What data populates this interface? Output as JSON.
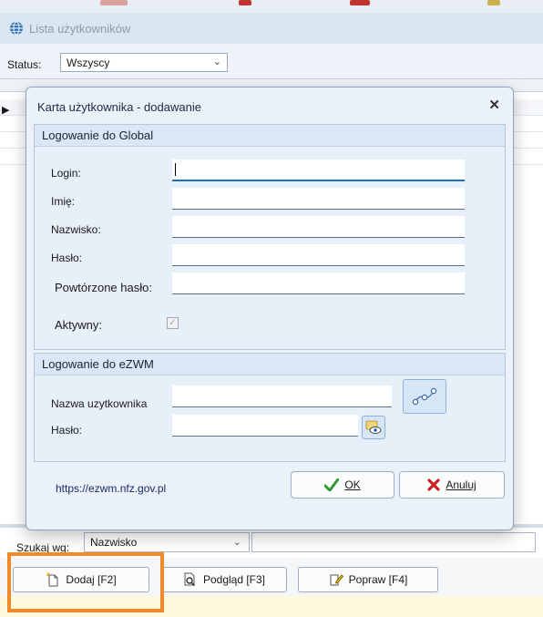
{
  "window": {
    "title": "Lista użytkowników"
  },
  "filter": {
    "status_label": "Status:",
    "status_value": "Wszyscy"
  },
  "search": {
    "label": "Szukaj wg:",
    "field_value": "Nazwisko"
  },
  "toolbar": {
    "add_label": "Dodaj [F2]",
    "preview_label": "Podgląd [F3]",
    "edit_label": "Popraw [F4]"
  },
  "dialog": {
    "title": "Karta użytkownika - dodawanie",
    "global_section": {
      "title": "Logowanie do Global",
      "login_label": "Login:",
      "first_name_label": "Imię:",
      "last_name_label": "Nazwisko:",
      "password_label": "Hasło:",
      "repeat_password_label": "Powtórzone hasło:",
      "active_label": "Aktywny:",
      "active_checked": true
    },
    "ezwm_section": {
      "title": "Logowanie do eZWM",
      "username_label": "Nazwa uzytkownika",
      "password_label": "Hasło:"
    },
    "link_text": "https://ezwm.nfz.gov.pl",
    "ok_label": "OK",
    "cancel_label": "Anuluj"
  },
  "colors": {
    "highlight": "#f08a2b",
    "ok_check": "#2e9a2e",
    "cancel_x": "#cc1f1f"
  }
}
